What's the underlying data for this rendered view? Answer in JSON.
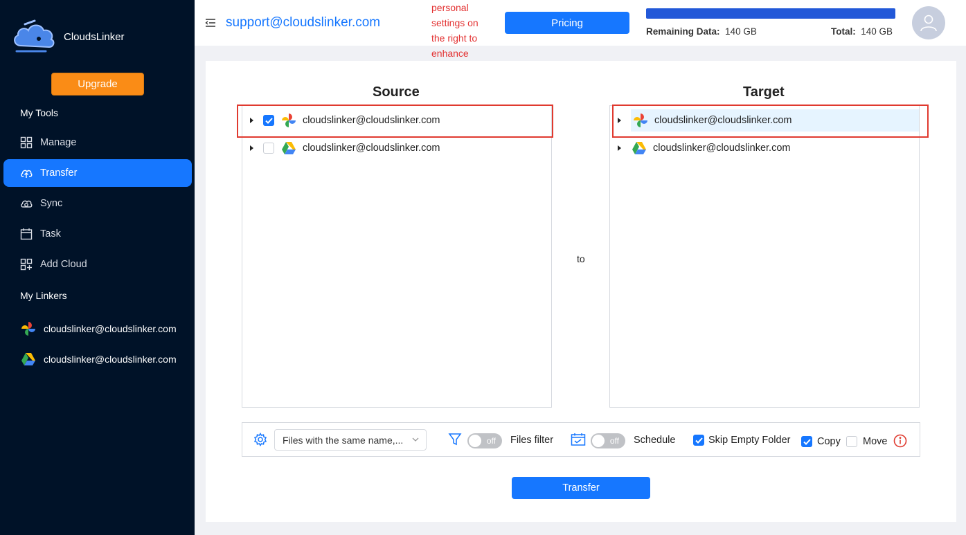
{
  "app": {
    "name": "CloudsLinker"
  },
  "sidebar": {
    "upgrade_label": "Upgrade",
    "my_tools_title": "My Tools",
    "items": [
      {
        "label": "Manage",
        "icon": "grid-icon"
      },
      {
        "label": "Transfer",
        "icon": "cloud-upload-icon",
        "active": true
      },
      {
        "label": "Sync",
        "icon": "cloud-sync-icon"
      },
      {
        "label": "Task",
        "icon": "calendar-icon"
      },
      {
        "label": "Add Cloud",
        "icon": "add-grid-icon"
      }
    ],
    "my_linkers_title": "My Linkers",
    "linkers": [
      {
        "label": "cloudslinker@cloudslinker.com",
        "icon": "google-photos-icon"
      },
      {
        "label": "cloudslinker@cloudslinker.com",
        "icon": "google-drive-icon"
      }
    ]
  },
  "header": {
    "email": "support@cloudslinker.com",
    "notice_lines": [
      "personal",
      "settings on",
      "the right to",
      "enhance"
    ],
    "pricing_label": "Pricing",
    "progress_fraction": 1.0,
    "remaining_label": "Remaining Data:",
    "remaining_value": "140 GB",
    "total_label": "Total:",
    "total_value": "140 GB"
  },
  "source": {
    "title": "Source",
    "rows": [
      {
        "label": "cloudslinker@cloudslinker.com",
        "icon": "google-photos-icon",
        "checked": true
      },
      {
        "label": "cloudslinker@cloudslinker.com",
        "icon": "google-drive-icon",
        "checked": false
      }
    ]
  },
  "to_label": "to",
  "target": {
    "title": "Target",
    "rows": [
      {
        "label": "cloudslinker@cloudslinker.com",
        "icon": "google-photos-icon",
        "selected": true
      },
      {
        "label": "cloudslinker@cloudslinker.com",
        "icon": "google-drive-icon",
        "selected": false
      }
    ]
  },
  "options": {
    "conflict_select": "Files with the same name,...",
    "files_filter_toggle": "off",
    "files_filter_label": "Files filter",
    "schedule_toggle": "off",
    "schedule_label": "Schedule",
    "skip_empty_label": "Skip Empty Folder",
    "skip_empty_checked": true,
    "copy_label": "Copy",
    "copy_checked": true,
    "move_label": "Move",
    "move_checked": false
  },
  "transfer_label": "Transfer",
  "colors": {
    "primary": "#1677ff",
    "sidebar": "#001228",
    "upgrade": "#fa8c16",
    "highlight": "#e03a2f"
  }
}
